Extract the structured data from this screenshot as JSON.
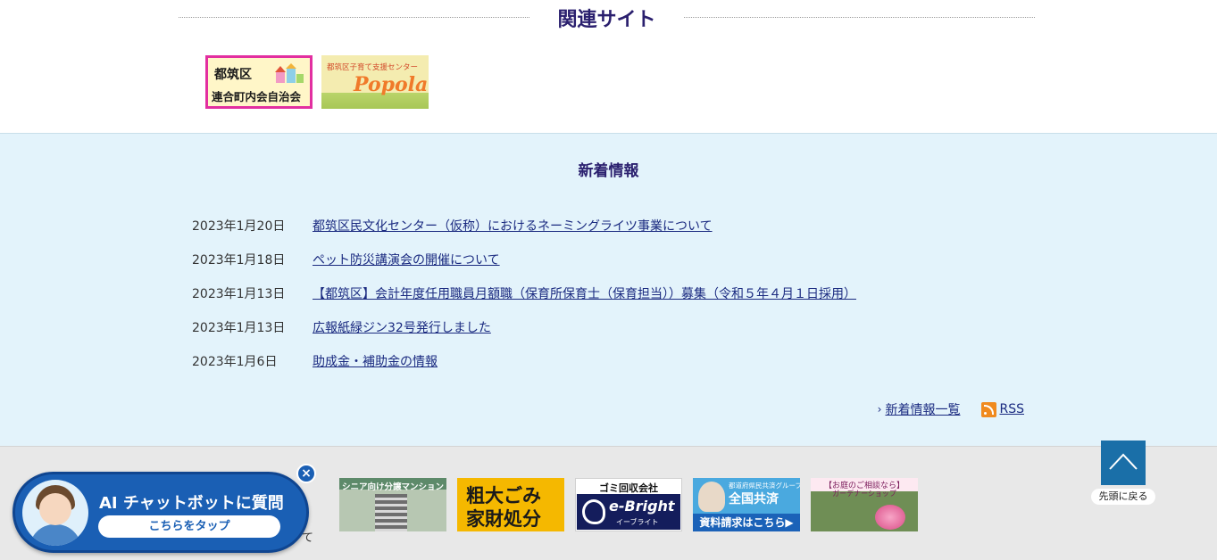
{
  "related": {
    "title": "関連サイト",
    "banners": [
      {
        "line1": "都筑区",
        "line2": "連合町内会自治会"
      },
      {
        "sub": "都筑区子育て支援センター",
        "logo": "Popola"
      }
    ]
  },
  "news": {
    "heading": "新着情報",
    "items": [
      {
        "date": "2023年1月20日",
        "title": "都筑区民文化センター（仮称）におけるネーミングライツ事業について"
      },
      {
        "date": "2023年1月18日",
        "title": "ペット防災講演会の開催について"
      },
      {
        "date": "2023年1月13日",
        "title": "【都筑区】会計年度任用職員月額職（保育所保育士（保育担当））募集（令和５年４月１日採用）"
      },
      {
        "date": "2023年1月13日",
        "title": "広報紙緑ジン32号発行しました"
      },
      {
        "date": "2023年1月6日",
        "title": "助成金・補助金の情報"
      }
    ],
    "more_label": "新着情報一覧",
    "rss_label": "RSS"
  },
  "footer": {
    "partial_text": "て",
    "ads": [
      {
        "caption": "シニア向け分譲マンション"
      },
      {
        "line1": "粗大ごみ",
        "line2": "家財処分"
      },
      {
        "top": "ゴミ回収会社",
        "logo": "e-Bright",
        "kana": "イーブライト"
      },
      {
        "l1": "都道府県民共済グループ",
        "l2": "全国共済",
        "bar": "資料請求はこちら▶"
      },
      {
        "cap": "【お庭のご相談なら】",
        "cap2": "ガーデナーショップ"
      }
    ]
  },
  "chatbot": {
    "title": "AI チャットボットに質問",
    "tap": "こちらをタップ",
    "close": "×"
  },
  "totop": {
    "label": "先頭に戻る"
  }
}
